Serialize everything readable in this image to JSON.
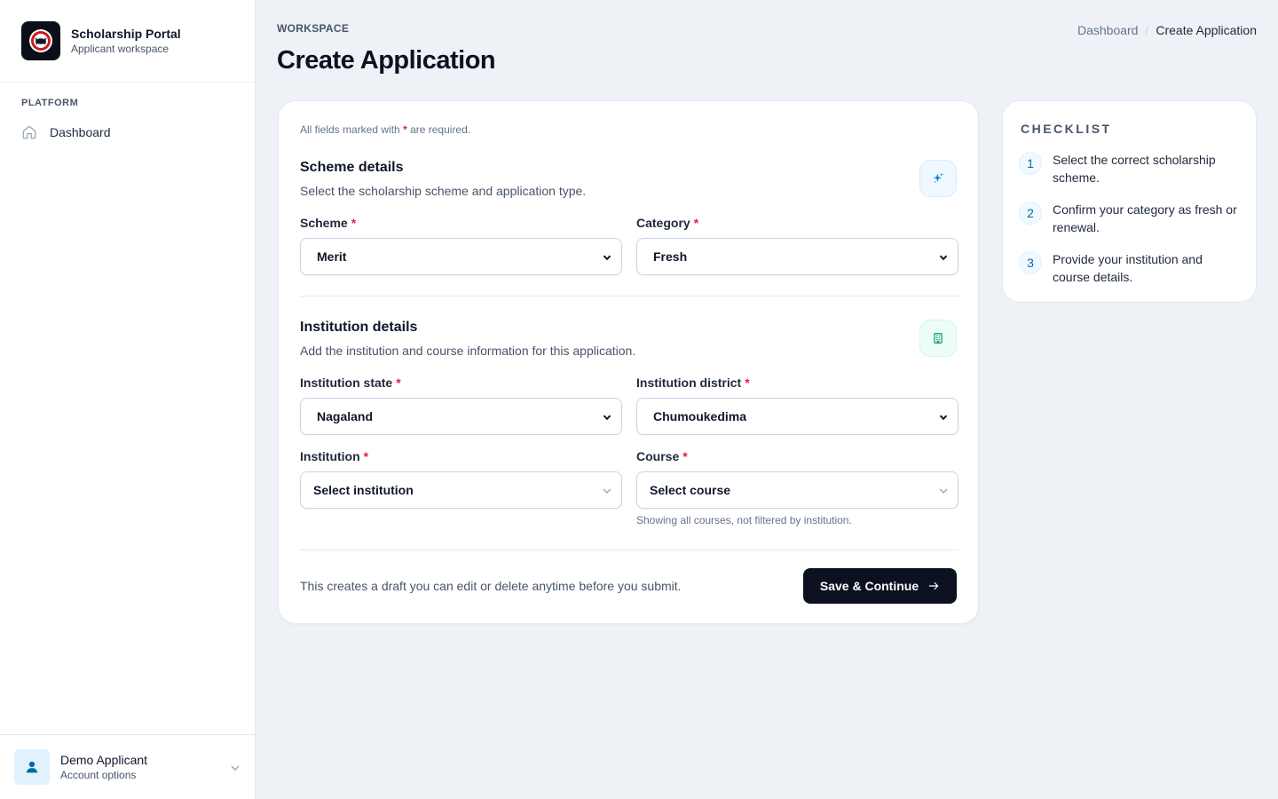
{
  "sidebar": {
    "brand_title": "Scholarship Portal",
    "brand_subtitle": "Applicant workspace",
    "section_heading": "PLATFORM",
    "nav_items": [
      {
        "label": "Dashboard",
        "icon": "home-icon"
      }
    ],
    "user": {
      "name": "Demo Applicant",
      "subtitle": "Account options",
      "icon": "user-icon"
    }
  },
  "header": {
    "eyebrow": "WORKSPACE",
    "title": "Create Application",
    "breadcrumb": {
      "parent": "Dashboard",
      "separator": "/",
      "current": "Create Application"
    }
  },
  "form": {
    "required_note_prefix": "All fields marked with",
    "required_star": "*",
    "required_note_suffix": "are required.",
    "scheme_section": {
      "title": "Scheme details",
      "description": "Select the scholarship scheme and application type.",
      "icon": "sparkles-icon",
      "fields": {
        "scheme": {
          "label": "Scheme",
          "value": "Merit"
        },
        "category": {
          "label": "Category",
          "value": "Fresh"
        }
      }
    },
    "institution_section": {
      "title": "Institution details",
      "description": "Add the institution and course information for this application.",
      "icon": "building-icon",
      "fields": {
        "state": {
          "label": "Institution state",
          "value": "Nagaland"
        },
        "district": {
          "label": "Institution district",
          "value": "Chumoukedima"
        },
        "institution": {
          "label": "Institution",
          "placeholder": "Select institution"
        },
        "course": {
          "label": "Course",
          "placeholder": "Select course",
          "hint": "Showing all courses, not filtered by institution."
        }
      }
    },
    "footer_note": "This creates a draft you can edit or delete anytime before you submit.",
    "submit_label": "Save & Continue"
  },
  "checklist": {
    "title": "CHECKLIST",
    "items": [
      {
        "number": "1",
        "text": "Select the correct scholarship scheme."
      },
      {
        "number": "2",
        "text": "Confirm your category as fresh or renewal."
      },
      {
        "number": "3",
        "text": "Provide your institution and course details."
      }
    ]
  },
  "colors": {
    "accent_dark": "#0b1120",
    "required": "#e11d48",
    "link_blue": "#0369a1",
    "bg": "#eef2f7"
  }
}
